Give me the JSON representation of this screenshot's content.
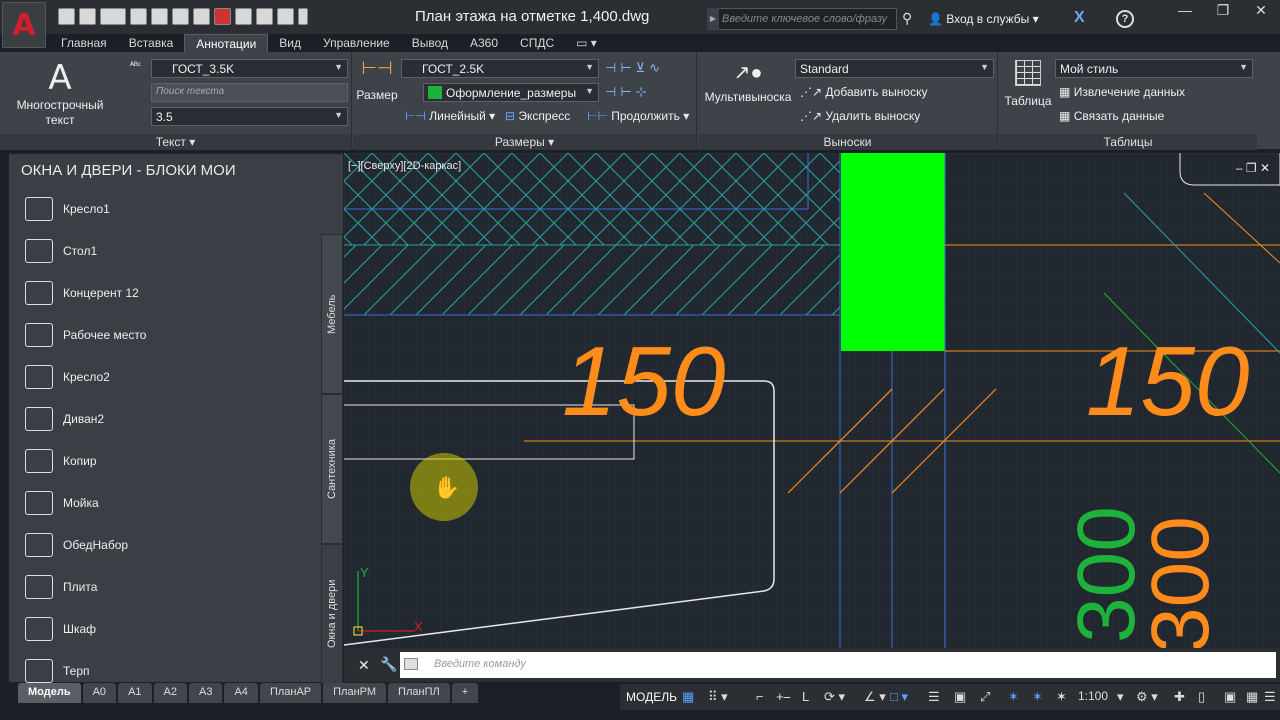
{
  "app": {
    "logo_letter": "A",
    "document_title": "План этажа на отметке 1,400.dwg",
    "search_placeholder": "Введите ключевое слово/фразу",
    "signin_label": "Вход в службы",
    "help_label": "?",
    "accent_color": "#d21e2a"
  },
  "ribbon_tabs": [
    "Главная",
    "Вставка",
    "Аннотации",
    "Вид",
    "Управление",
    "Вывод",
    "А360",
    "СПДС"
  ],
  "active_tab": "Аннотации",
  "ribbon": {
    "text_panel": {
      "title": "Текст",
      "multiline_label": "Многострочный текст",
      "style_value": "ГОСТ_3.5K",
      "search_placeholder": "Поиск текста",
      "height_value": "3.5"
    },
    "dim_panel": {
      "title": "Размеры",
      "dimension_label": "Размер",
      "dimstyle_value": "ГОСТ_2.5K",
      "layer_value": "Оформление_размеры",
      "linear_label": "Линейный",
      "express_label": "Экспресс",
      "continue_label": "Продолжить"
    },
    "leader_panel": {
      "title": "Выноски",
      "mleader_label": "Мультивыноска",
      "style_value": "Standard",
      "add_label": "Добавить выноску",
      "remove_label": "Удалить выноску"
    },
    "table_panel": {
      "title": "Таблицы",
      "table_label": "Таблица",
      "style_value": "Мой стиль",
      "extract_label": "Извлечение данных",
      "link_label": "Связать данные"
    }
  },
  "palette": {
    "title": "ОКНА И ДВЕРИ - БЛОКИ МОИ",
    "items": [
      "Кресло1",
      "Стол1",
      "Концерент 12",
      "Рабочее место",
      "Кресло2",
      "Диван2",
      "Копир",
      "Мойка",
      "ОбедНабор",
      "Плита",
      "Шкаф",
      "Терп"
    ],
    "tabs": [
      "Мебель",
      "Сантехника",
      "Окна и двери"
    ]
  },
  "viewport": {
    "label": "[−][Сверху][2D-каркас]",
    "dim_text_left": "150",
    "dim_text_right": "150",
    "dim_text_300": "300",
    "axis_y": "Y",
    "axis_x": "X",
    "controls": "–  ❐  ✕",
    "hatch_color": "#2aa1a1",
    "green_block_color": "#00ff00",
    "dim_color": "#ff8c1a",
    "green_text_color": "#1db33a"
  },
  "command": {
    "placeholder": "Введите команду"
  },
  "layout_tabs": [
    "Модель",
    "А0",
    "А1",
    "А2",
    "А3",
    "А4",
    "ПланАР",
    "ПланРМ",
    "ПланПЛ",
    "+"
  ],
  "status": {
    "model_label": "МОДЕЛЬ",
    "scale_label": "1:100"
  }
}
